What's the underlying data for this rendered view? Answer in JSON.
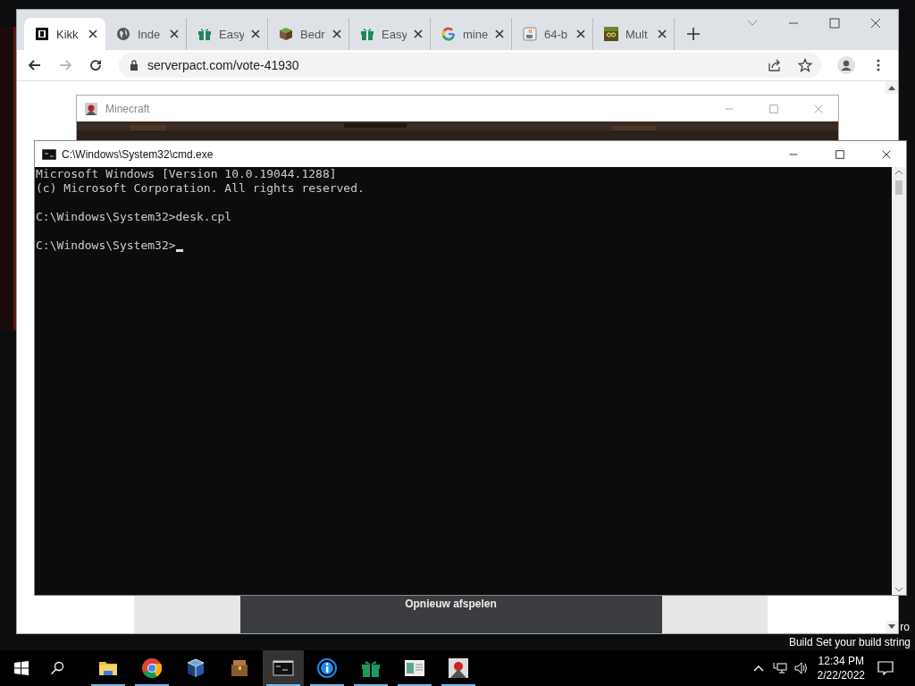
{
  "browser": {
    "tabs": [
      {
        "title": "Kikk",
        "kind": "box",
        "selected": true
      },
      {
        "title": "Inde",
        "kind": "globe",
        "selected": false
      },
      {
        "title": "Easy",
        "kind": "gift",
        "selected": false
      },
      {
        "title": "Bedr",
        "kind": "grass",
        "selected": false
      },
      {
        "title": "Easy",
        "kind": "gift",
        "selected": false
      },
      {
        "title": "mine",
        "kind": "google",
        "selected": false
      },
      {
        "title": "64-b",
        "kind": "java",
        "selected": false
      },
      {
        "title": "Mult",
        "kind": "loop",
        "selected": false
      }
    ],
    "url": "serverpact.com/vote-41930",
    "forward_disabled": true,
    "page_button": "Opnieuw afspelen"
  },
  "minecraft_window": {
    "title": "Minecraft"
  },
  "cmd_window": {
    "title": "C:\\Windows\\System32\\cmd.exe",
    "paragraphs": [
      [
        "Microsoft Windows [Version 10.0.19044.1288]",
        "(c) Microsoft Corporation. All rights reserved."
      ],
      [
        "C:\\Windows\\System32>desk.cpl"
      ],
      [
        "C:\\Windows\\System32>"
      ]
    ],
    "cursor": true
  },
  "desktop": {
    "edition_text": "ro",
    "build_text": "Build Set your build string"
  },
  "taskbar": {
    "apps": [
      {
        "kind": "folder",
        "running": true,
        "selected": false
      },
      {
        "kind": "chrome",
        "running": true,
        "selected": false
      },
      {
        "kind": "cube",
        "running": false,
        "selected": false
      },
      {
        "kind": "chest",
        "running": false,
        "selected": false
      },
      {
        "kind": "terminal",
        "running": true,
        "selected": true
      },
      {
        "kind": "info",
        "running": true,
        "selected": false
      },
      {
        "kind": "gift",
        "running": true,
        "selected": false
      },
      {
        "kind": "sheet",
        "running": true,
        "selected": false
      },
      {
        "kind": "java",
        "running": true,
        "selected": false
      }
    ],
    "time": "12:34 PM",
    "date": "2/22/2022"
  }
}
